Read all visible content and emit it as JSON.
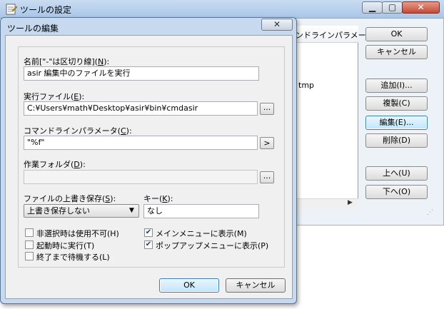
{
  "back_dialog": {
    "title": "ツールの設定",
    "window_buttons": {
      "minimize": "▁",
      "maximize": "▢",
      "close": "✕"
    },
    "list": {
      "column_header": "ンドラインパラメータ",
      "cell_fragment": "tmp"
    },
    "buttons": {
      "ok": "OK",
      "cancel": "キャンセル",
      "add": "追加(I)...",
      "copy": "複製(C)",
      "edit": "編集(E)...",
      "delete": "削除(D)",
      "up": "上へ(U)",
      "down": "下へ(O)"
    }
  },
  "dialog": {
    "title": "ツールの編集",
    "close_symbol": "✕",
    "name": {
      "label_pre": "名前[\"-\"は区切り線](",
      "key": "N",
      "label_post": "):",
      "value": "asir 編集中のファイルを実行"
    },
    "exe": {
      "label_pre": "実行ファイル(",
      "key": "E",
      "label_post": "):",
      "value": "C:¥Users¥math¥Desktop¥asir¥bin¥cmdasir",
      "browse": "..."
    },
    "params": {
      "label_pre": "コマンドラインパラメータ(",
      "key": "C",
      "label_post": "):",
      "value": "\"%f\"",
      "arrow": ">"
    },
    "workdir": {
      "label_pre": "作業フォルダ(",
      "key": "D",
      "label_post": "):",
      "value": "",
      "browse": "..."
    },
    "overwrite": {
      "label_pre": "ファイルの上書き保存(",
      "key": "S",
      "label_post": "):",
      "selected": "上書き保存しない"
    },
    "key": {
      "label_pre": "キー(",
      "key": "K",
      "label_post": "):",
      "value": "なし"
    },
    "checkboxes": [
      {
        "label": "非選択時は使用不可(H)",
        "checked": false
      },
      {
        "label": "起動時に実行(T)",
        "checked": false
      },
      {
        "label": "終了まで待機する(L)",
        "checked": false
      },
      {
        "label": "メインメニューに表示(M)",
        "checked": true
      },
      {
        "label": "ポップアップメニューに表示(P)",
        "checked": true
      }
    ],
    "ok": "OK",
    "cancel": "キャンセル"
  }
}
